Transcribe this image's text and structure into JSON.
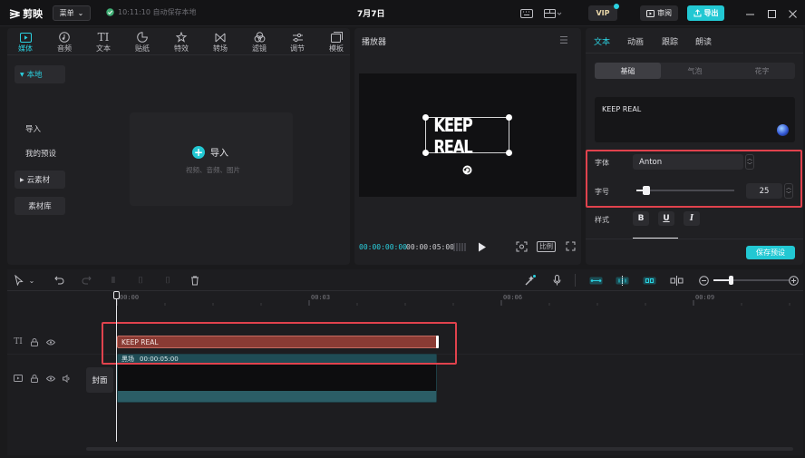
{
  "app": {
    "name": "剪映",
    "menu_label": "菜单",
    "save_status": "10:11:10 自动保存本地",
    "doc_title": "7月7日",
    "vip_label": "VIP",
    "review_label": "审阅",
    "export_label": "导出"
  },
  "media": {
    "tabs": [
      {
        "label": "媒体",
        "icon": "media-icon"
      },
      {
        "label": "音频",
        "icon": "audio-icon"
      },
      {
        "label": "文本",
        "icon": "text-icon"
      },
      {
        "label": "贴纸",
        "icon": "sticker-icon"
      },
      {
        "label": "特效",
        "icon": "effects-icon"
      },
      {
        "label": "转场",
        "icon": "transition-icon"
      },
      {
        "label": "滤镜",
        "icon": "filter-icon"
      },
      {
        "label": "调节",
        "icon": "adjust-icon"
      },
      {
        "label": "模板",
        "icon": "template-icon"
      }
    ],
    "sidebar": [
      "本地",
      "导入",
      "我的预设",
      "云素材",
      "素材库"
    ],
    "import_label": "导入",
    "import_sub": "视频、音频、图片"
  },
  "player": {
    "title": "播放器",
    "canvas_text": "KEEP REAL",
    "timecode_current": "00:00:00:00",
    "timecode_total": "00:00:05:00",
    "ratio_label": "比例"
  },
  "inspector": {
    "tabs": [
      "文本",
      "动画",
      "跟踪",
      "朗读"
    ],
    "segments": [
      "基础",
      "气泡",
      "花字"
    ],
    "text_value": "KEEP REAL",
    "font_label": "字体",
    "font_value": "Anton",
    "size_label": "字号",
    "size_value": "25",
    "size_fraction": 0.1,
    "style_label": "样式",
    "style_buttons": [
      "B",
      "U",
      "I"
    ],
    "save_preset_label": "保存预设"
  },
  "timeline": {
    "ruler": [
      "00:00",
      "00:03",
      "00:06",
      "00:09"
    ],
    "text_clip_label": "KEEP REAL",
    "video_clip_label": "黑场",
    "video_clip_duration": "00:00:05:00",
    "cover_label": "封面",
    "text_track_icon": "TI"
  },
  "colors": {
    "accent": "#22c8d3",
    "highlight_box": "#e0424d",
    "text_clip": "#8a3b34",
    "video_clip": "#1f4c55"
  }
}
